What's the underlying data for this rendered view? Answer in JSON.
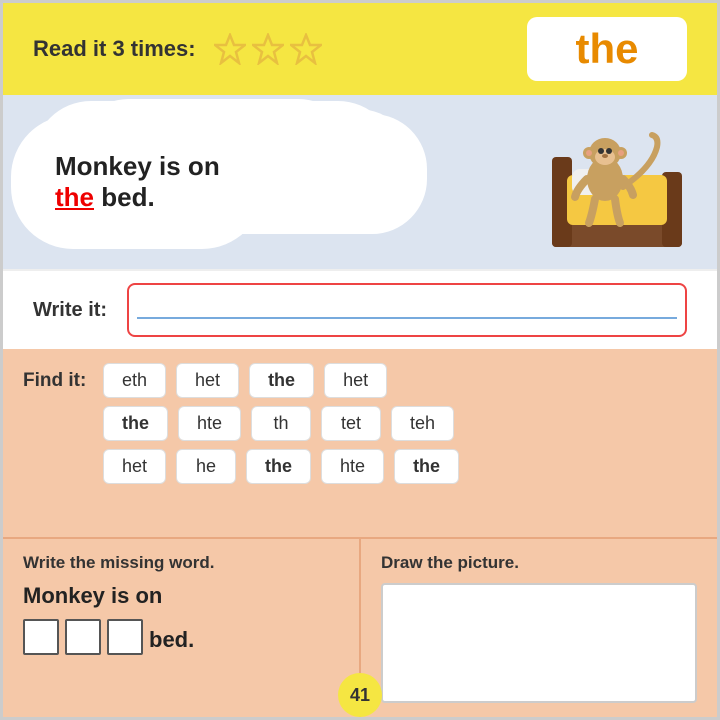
{
  "header": {
    "read_label": "Read it 3 times:",
    "stars": [
      "★",
      "★",
      "★"
    ],
    "sight_word": "the"
  },
  "story": {
    "sentence_part1": "Monkey is on",
    "sentence_highlight": "the",
    "sentence_part2": "bed.",
    "full_sentence": "Monkey is on the bed."
  },
  "write_section": {
    "label": "Write it:"
  },
  "find_section": {
    "label": "Find it:",
    "rows": [
      [
        "eth",
        "het",
        "the",
        "het"
      ],
      [
        "the",
        "hte",
        "th",
        "tet",
        "teh"
      ],
      [
        "het",
        "he",
        "the",
        "hte",
        "the"
      ]
    ],
    "correct_word": "the"
  },
  "bottom": {
    "write_title": "Write the missing word.",
    "draw_title": "Draw the picture.",
    "monkey_sentence_part1": "Monkey is on",
    "blank_count": 3,
    "bed_text": "bed."
  },
  "page_number": "41"
}
